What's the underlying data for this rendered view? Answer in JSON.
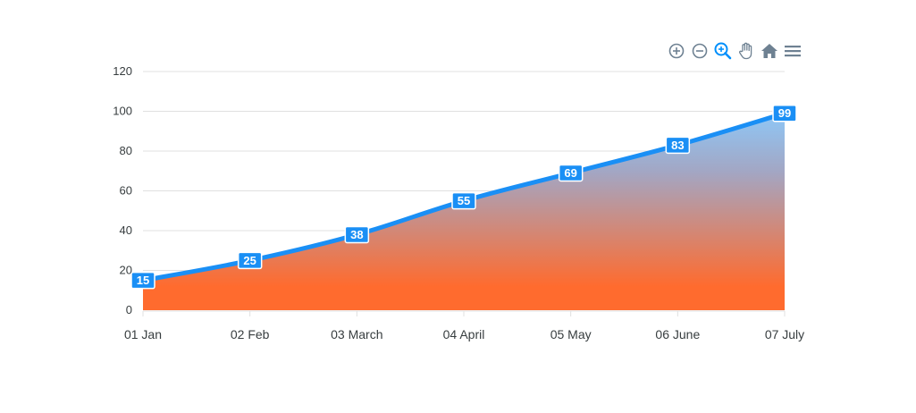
{
  "toolbar": {
    "icons": [
      "zoom-in-icon",
      "zoom-out-icon",
      "selection-zoom-icon",
      "pan-hand-icon",
      "home-reset-icon",
      "menu-icon"
    ],
    "icon_color": "#6e8192",
    "active_icon_color": "#008ffb"
  },
  "colors": {
    "line": "#1a8ff5",
    "label_bg": "#1a8ff5",
    "gradient_top": "#8ec7f7",
    "gradient_bottom": "#ff6b2e",
    "grid": "#e0e0e0"
  },
  "chart_data": {
    "type": "area",
    "categories": [
      "01 Jan",
      "02 Feb",
      "03 March",
      "04 April",
      "05 May",
      "06 June",
      "07 July"
    ],
    "series": [
      {
        "values": [
          15,
          25,
          38,
          55,
          69,
          83,
          99
        ]
      }
    ],
    "yticks": [
      "0",
      "20",
      "40",
      "60",
      "80",
      "100",
      "120"
    ],
    "ylim": [
      0,
      120
    ],
    "grid": true,
    "data_labels": true,
    "curve": "smooth"
  }
}
